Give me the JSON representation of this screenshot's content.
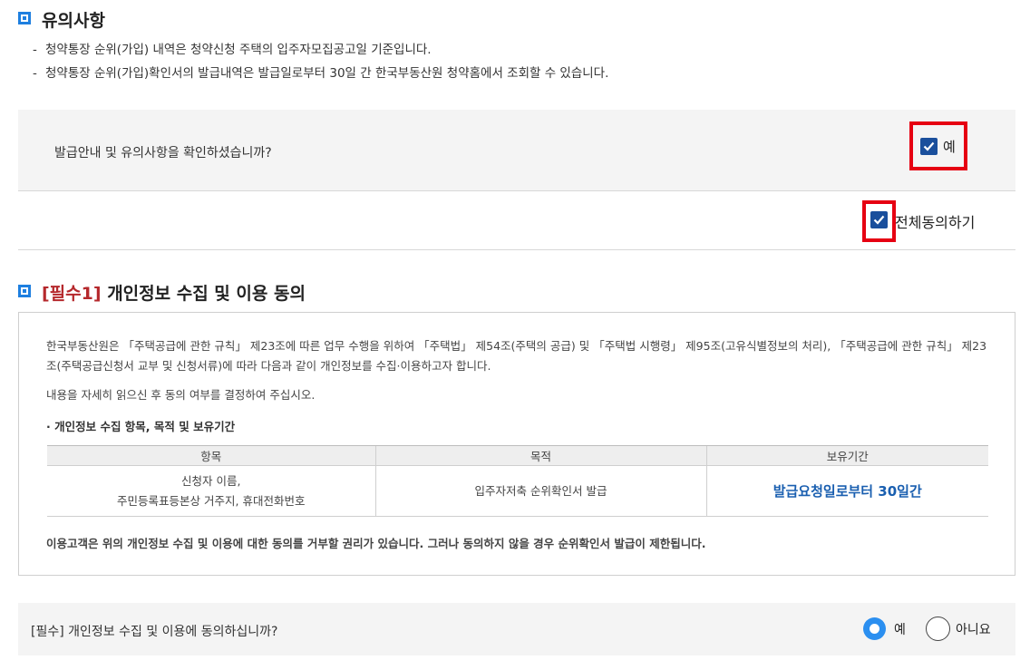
{
  "notice": {
    "title": "유의사항",
    "items": [
      "청약통장 순위(가입) 내역은 청약신청 주택의 입주자모집공고일 기준입니다.",
      "청약통장 순위(가입)확인서의 발급내역은 발급일로부터 30일 간 한국부동산원 청약홈에서 조회할 수 있습니다."
    ]
  },
  "confirm": {
    "question": "발급안내 및 유의사항을 확인하셨습니까?",
    "yes_label": "예",
    "checked": true
  },
  "agree_all": {
    "label": "전체동의하기",
    "checked": true
  },
  "privacy": {
    "required_tag": "[필수1]",
    "title": "개인정보 수집 및 이용 동의",
    "intro": "한국부동산원은 「주택공급에 관한 규칙」 제23조에 따른 업무 수행을 위하여 「주택법」 제54조(주택의 공급) 및 「주택법 시행령」 제95조(고유식별정보의 처리), 「주택공급에 관한 규칙」 제23조(주택공급신청서 교부 및 신청서류)에 따라 다음과 같이 개인정보를 수집·이용하고자 합니다.",
    "read_notice": "내용을 자세히 읽으신 후 동의 여부를 결정하여 주십시오.",
    "subtitle": "· 개인정보 수집 항목, 목적 및 보유기간",
    "table": {
      "headers": [
        "항목",
        "목적",
        "보유기간"
      ],
      "row": {
        "item_line1": "신청자 이름,",
        "item_line2": "주민등록표등본상 거주지, 휴대전화번호",
        "purpose": "입주자저축 순위확인서 발급",
        "period": "발급요청일로부터 30일간"
      }
    },
    "rights": "이용고객은 위의 개인정보 수집 및 이용에 대한 동의를 거부할 권리가 있습니다. 그러나 동의하지 않을 경우 순위확인서 발급이 제한됩니다."
  },
  "consent": {
    "required_tag": "[필수]",
    "question": "개인정보 수집 및 이용에 동의하십니까?",
    "yes_label": "예",
    "no_label": "아니요",
    "selected": "예"
  },
  "colors": {
    "accent_blue": "#1e7fe0",
    "checkbox_navy": "#1a4f9c",
    "highlight_red": "#e60012",
    "required_red": "#b5282c",
    "radio_blue": "#2b8ff0"
  }
}
